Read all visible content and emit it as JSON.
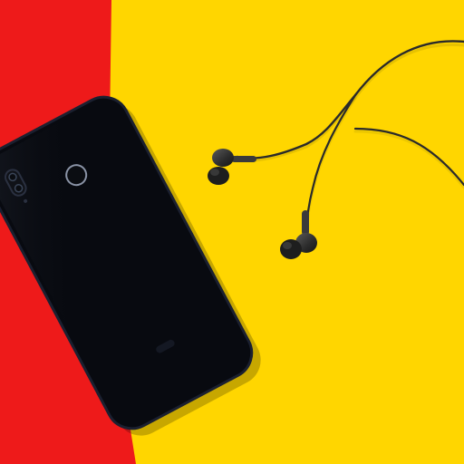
{
  "scene": {
    "background_colors": {
      "red_panel": "#ee1a1a",
      "yellow_panel": "#ffd600"
    },
    "objects": {
      "phone_color": "#080a10",
      "earphones_color": "#2b2b2b",
      "cable_color": "#2a2a2a"
    }
  }
}
